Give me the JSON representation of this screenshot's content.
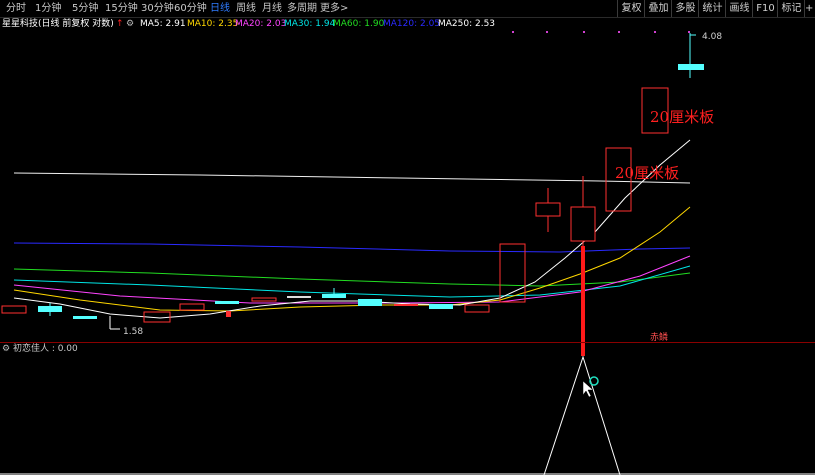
{
  "toolbar": {
    "periods": [
      "分时",
      "1分钟",
      "5分钟",
      "15分钟",
      "30分钟",
      "60分钟",
      "日线",
      "周线",
      "月线",
      "多周期",
      "更多>"
    ],
    "active_period": "日线",
    "buttons": [
      "复权",
      "叠加",
      "多股",
      "统计",
      "画线",
      "F10",
      "标记",
      "+自"
    ]
  },
  "info": {
    "title": "星星科技(日线 前复权 对数)",
    "ma": [
      {
        "label": "MA5: 2.91",
        "color": "#ffffff"
      },
      {
        "label": "MA10: 2.35",
        "color": "#ffd700"
      },
      {
        "label": "MA20: 2.03",
        "color": "#ff44ff"
      },
      {
        "label": "MA30: 1.94",
        "color": "#00e5e5"
      },
      {
        "label": "MA60: 1.90",
        "color": "#22dd22"
      },
      {
        "label": "MA120: 2.05",
        "color": "#2a2aff"
      },
      {
        "label": "MA250: 2.53",
        "color": "#ffffff"
      }
    ]
  },
  "annotations": {
    "high": "4.08",
    "low": "1.58",
    "board1": "20厘米板",
    "board2": "20厘米板",
    "tag": "赤鳞"
  },
  "indicator": {
    "label": "初恋佳人 : 0.00"
  },
  "colors": {
    "up": "#ff3030",
    "down": "#54ffff",
    "bg": "#000000",
    "accent": "#2f7bff"
  }
}
